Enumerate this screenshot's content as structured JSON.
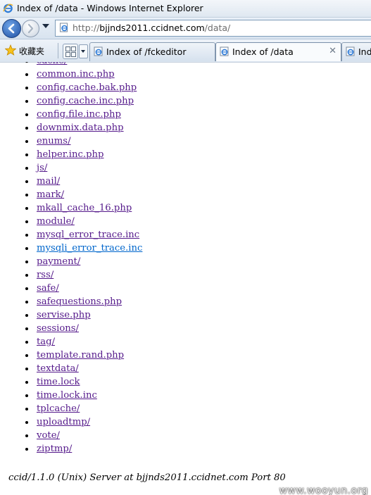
{
  "window": {
    "title": "Index of /data - Windows Internet Explorer"
  },
  "nav": {
    "address_prefix": "http://",
    "address_domain": "bjjnds2011.ccidnet.com",
    "address_suffix": "/data/"
  },
  "tabbar": {
    "favorites_label": "收藏夹",
    "tabs": [
      {
        "label": "Index of /fckeditor",
        "active": false
      },
      {
        "label": "Index of /data",
        "active": true
      },
      {
        "label": "Ind",
        "active": false
      }
    ],
    "close_glyph": "✕"
  },
  "listing": {
    "files": [
      "cache/",
      "common.inc.php",
      "config.cache.bak.php",
      "config.cache.inc.php",
      "config.file.inc.php",
      "downmix.data.php",
      "enums/",
      "helper.inc.php",
      "js/",
      "mail/",
      "mark/",
      "mkall_cache_16.php",
      "module/",
      "mysql_error_trace.inc",
      "mysqli_error_trace.inc",
      "payment/",
      "rss/",
      "safe/",
      "safequestions.php",
      "servise.php",
      "sessions/",
      "tag/",
      "template.rand.php",
      "textdata/",
      "time.lock",
      "time.lock.inc",
      "tplcache/",
      "uploadtmp/",
      "vote/",
      "ziptmp/"
    ],
    "unvisited_index": 14,
    "server_address": "ccid/1.1.0 (Unix) Server at bjjnds2011.ccidnet.com Port 80"
  },
  "watermark": "www.wooyun.org",
  "colors": {
    "visited_link": "#551a8b",
    "unvisited_link": "#0066cc"
  }
}
